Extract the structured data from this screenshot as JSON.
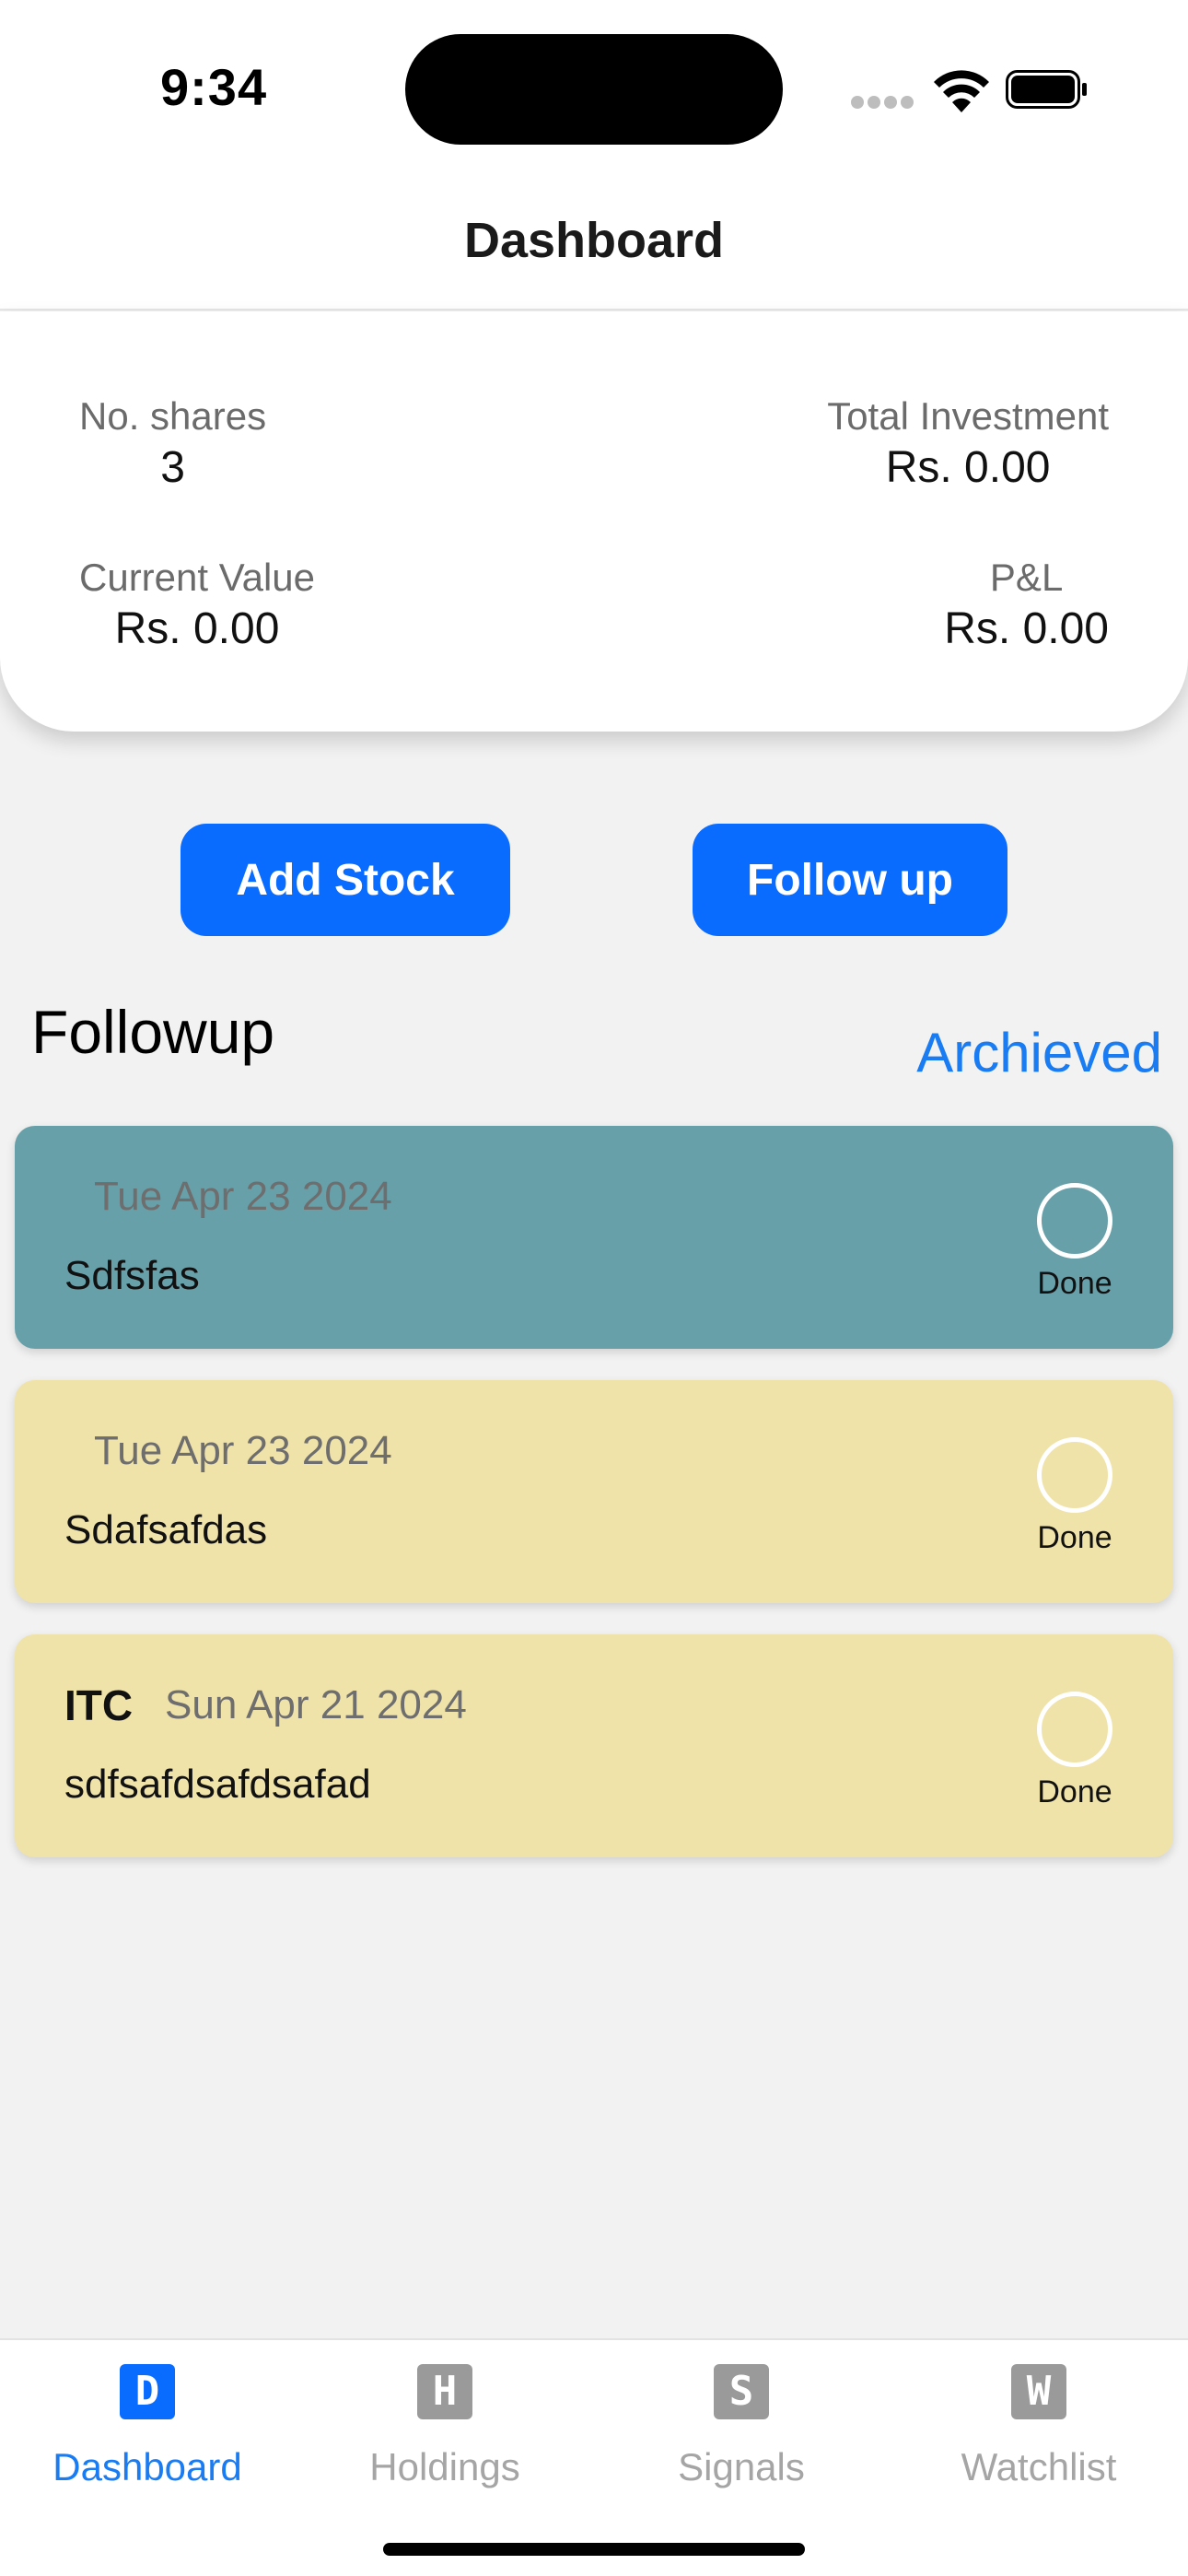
{
  "status_bar": {
    "time": "9:34"
  },
  "header": {
    "title": "Dashboard"
  },
  "summary": {
    "shares_label": "No. shares",
    "shares_value": "3",
    "investment_label": "Total Investment",
    "investment_value": "Rs. 0.00",
    "current_label": "Current Value",
    "current_value": "Rs. 0.00",
    "pl_label": "P&L",
    "pl_value": "Rs. 0.00"
  },
  "actions": {
    "add_stock": "Add Stock",
    "follow_up": "Follow up"
  },
  "followup": {
    "title": "Followup",
    "archived_link": "Archieved",
    "items": [
      {
        "stock": "",
        "date": "Tue Apr 23 2024",
        "note": "Sdfsfas",
        "done_label": "Done",
        "color": "#68a0aa"
      },
      {
        "stock": "",
        "date": "Tue Apr 23 2024",
        "note": "Sdafsafdas",
        "done_label": "Done",
        "color": "#f0e3aa"
      },
      {
        "stock": "ITC",
        "date": "Sun Apr 21 2024",
        "note": "sdfsafdsafdsafad",
        "done_label": "Done",
        "color": "#f0e3aa"
      }
    ]
  },
  "tabbar": {
    "tabs": [
      {
        "icon": "D",
        "label": "Dashboard",
        "active": true
      },
      {
        "icon": "H",
        "label": "Holdings",
        "active": false
      },
      {
        "icon": "S",
        "label": "Signals",
        "active": false
      },
      {
        "icon": "W",
        "label": "Watchlist",
        "active": false
      }
    ]
  },
  "colors": {
    "accent": "#0a6cff",
    "link": "#1a7cf2",
    "card_teal": "#68a0aa",
    "card_yellow": "#f0e3aa"
  }
}
